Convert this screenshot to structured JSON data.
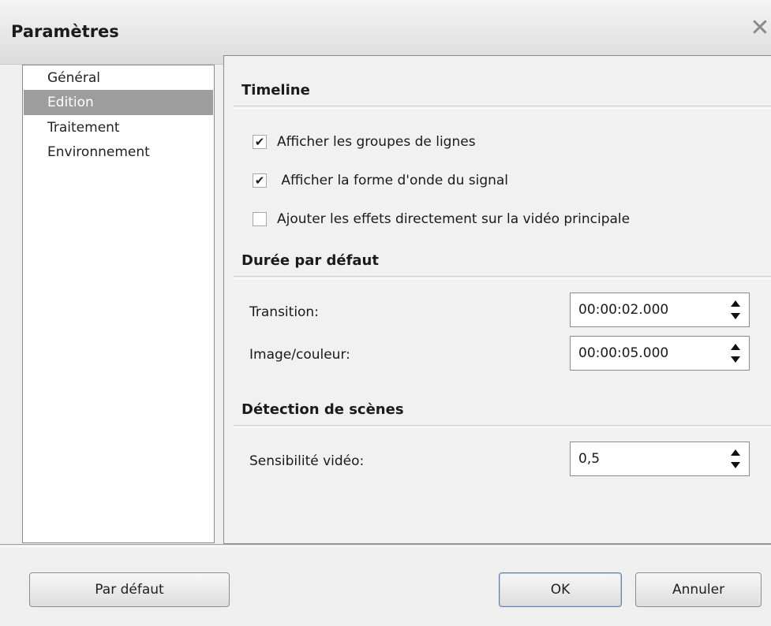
{
  "window": {
    "title": "Paramètres"
  },
  "sidebar": {
    "items": [
      {
        "label": "Général"
      },
      {
        "label": "Edition"
      },
      {
        "label": "Traitement"
      },
      {
        "label": "Environnement"
      }
    ],
    "selected": "Edition"
  },
  "timeline": {
    "title": "Timeline",
    "options": [
      {
        "label": "Afficher les groupes de lignes",
        "checked": true
      },
      {
        "label": " Afficher la forme d'onde du signal",
        "checked": true
      },
      {
        "label": "Ajouter les effets directement sur la vidéo principale",
        "checked": false
      }
    ]
  },
  "duree": {
    "title": "Durée par défaut",
    "fields": [
      {
        "label": "Transition:",
        "value": "00:00:02.000"
      },
      {
        "label": "Image/couleur:",
        "value": "00:00:05.000"
      }
    ]
  },
  "detection": {
    "title": "Détection de scènes",
    "fields": [
      {
        "label": "Sensibilité vidéo:",
        "value": "0,5"
      }
    ]
  },
  "buttons": {
    "default_label": "Par défaut",
    "ok_label": "OK",
    "cancel_label": "Annuler"
  },
  "icons": {
    "close": "close-icon",
    "check": "checkmark-icon",
    "spin": "spin-arrows-icon"
  },
  "colors": {
    "selected_bg": "#9d9d9d",
    "panel_bg": "#f2f1f1",
    "window_bg": "#f0efef"
  }
}
